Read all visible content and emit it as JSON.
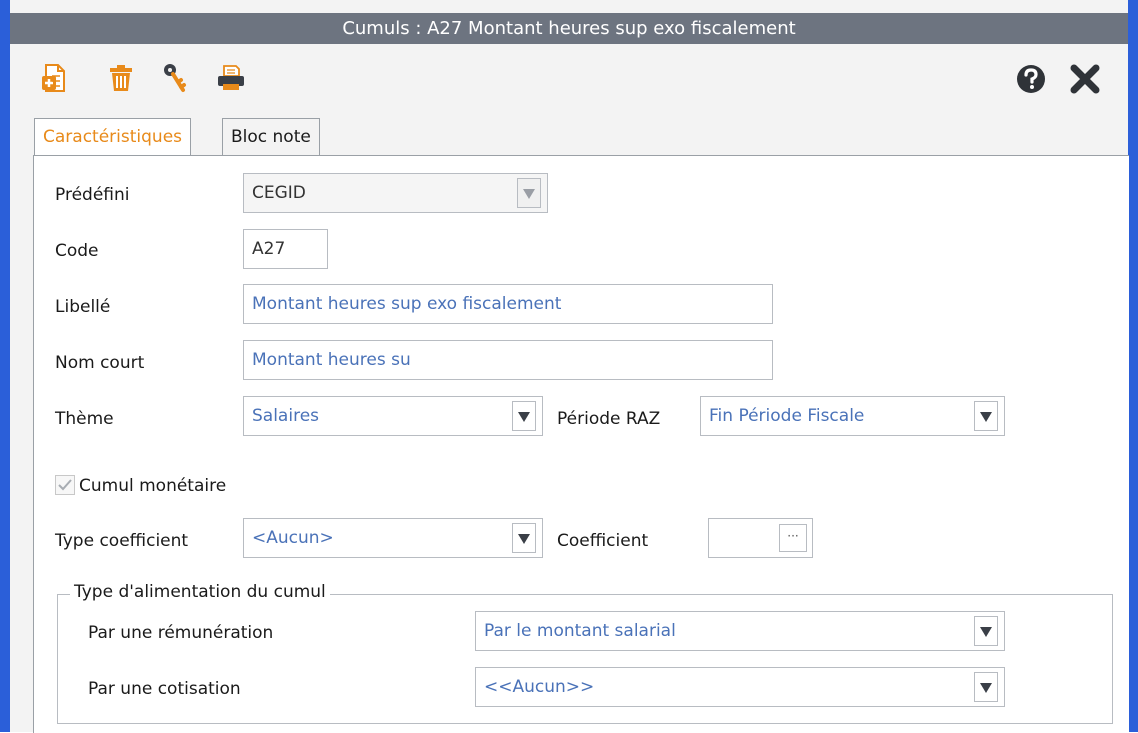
{
  "window": {
    "title": "Cumuls  : A27 Montant heures sup exo fiscalement"
  },
  "toolbar": {
    "icons": [
      "new-document-icon",
      "trash-icon",
      "key-icon",
      "print-icon",
      "help-icon",
      "close-icon"
    ]
  },
  "tabs": [
    {
      "label": "Caractéristiques",
      "active": true
    },
    {
      "label": "Bloc note",
      "active": false
    }
  ],
  "form": {
    "predefini": {
      "label": "Prédéfini",
      "value": "CEGID"
    },
    "code": {
      "label": "Code",
      "value": "A27"
    },
    "libelle": {
      "label": "Libellé",
      "value": "Montant heures sup exo fiscalement"
    },
    "nom_court": {
      "label": "Nom court",
      "value": "Montant heures su"
    },
    "theme": {
      "label": "Thème",
      "value": "Salaires"
    },
    "periode_raz": {
      "label": "Période RAZ",
      "value": "Fin Période Fiscale"
    },
    "cumul_monetaire": {
      "label": "Cumul monétaire",
      "checked": true
    },
    "type_coefficient": {
      "label": "Type coefficient",
      "value": "<Aucun>"
    },
    "coefficient": {
      "label": "Coefficient",
      "value": "",
      "button_label": "···"
    }
  },
  "alimentation": {
    "title": "Type d'alimentation du cumul",
    "remuneration": {
      "label": "Par une rémunération",
      "value": "Par le montant salarial"
    },
    "cotisation": {
      "label": "Par une cotisation",
      "value": "<<Aucun>>"
    }
  },
  "colors": {
    "title_bar": "#6d7480",
    "window_edge": "#2b5fd9",
    "active_tab_text": "#e88a1a",
    "field_text": "#4a72b8"
  }
}
